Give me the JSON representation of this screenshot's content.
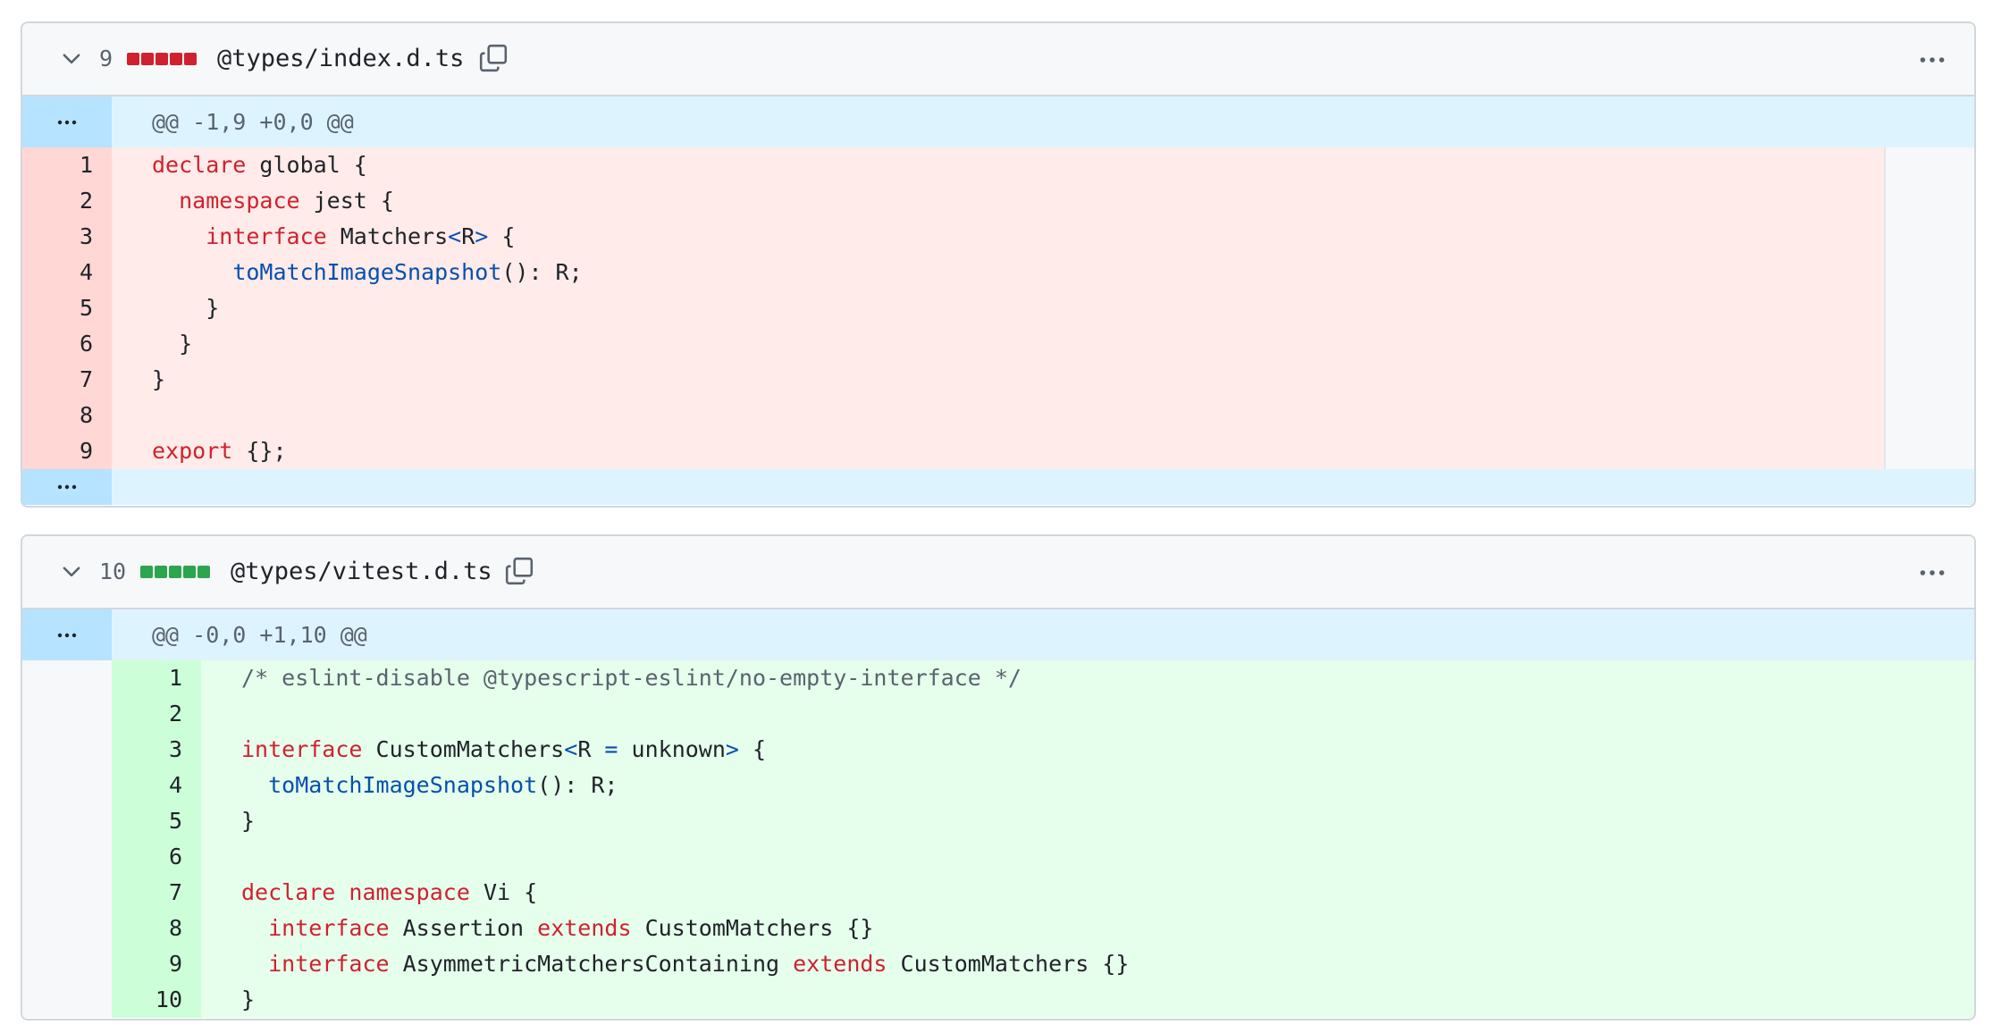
{
  "files": [
    {
      "count": "9",
      "kind": "deleted",
      "name": "@types/index.d.ts",
      "hunk": "@@ -1,9 +0,0 @@",
      "lines": [
        {
          "n": "1",
          "html": "<span class=\"k\">declare</span> global {"
        },
        {
          "n": "2",
          "html": "  <span class=\"k\">namespace</span> jest {"
        },
        {
          "n": "3",
          "html": "    <span class=\"k\">interface</span> Matchers<span class=\"p\">&lt;</span>R<span class=\"p\">&gt;</span> {"
        },
        {
          "n": "4",
          "html": "      <span class=\"f\">toMatchImageSnapshot</span>(): R;"
        },
        {
          "n": "5",
          "html": "    }"
        },
        {
          "n": "6",
          "html": "  }"
        },
        {
          "n": "7",
          "html": "}"
        },
        {
          "n": "8",
          "html": ""
        },
        {
          "n": "9",
          "html": "<span class=\"k\">export</span> {};"
        }
      ]
    },
    {
      "count": "10",
      "kind": "added",
      "name": "@types/vitest.d.ts",
      "hunk": "@@ -0,0 +1,10 @@",
      "lines": [
        {
          "n": "1",
          "html": "<span class=\"c\">/* eslint-disable @typescript-eslint/no-empty-interface */</span>"
        },
        {
          "n": "2",
          "html": ""
        },
        {
          "n": "3",
          "html": "<span class=\"k\">interface</span> CustomMatchers<span class=\"p\">&lt;</span>R <span class=\"p\">=</span> unknown<span class=\"p\">&gt;</span> {"
        },
        {
          "n": "4",
          "html": "  <span class=\"f\">toMatchImageSnapshot</span>(): R;"
        },
        {
          "n": "5",
          "html": "}"
        },
        {
          "n": "6",
          "html": ""
        },
        {
          "n": "7",
          "html": "<span class=\"k\">declare</span> <span class=\"k\">namespace</span> Vi {"
        },
        {
          "n": "8",
          "html": "  <span class=\"k\">interface</span> Assertion <span class=\"k\">extends</span> CustomMatchers {}"
        },
        {
          "n": "9",
          "html": "  <span class=\"k\">interface</span> AsymmetricMatchersContaining <span class=\"k\">extends</span> CustomMatchers {}"
        },
        {
          "n": "10",
          "html": "}"
        }
      ]
    }
  ],
  "colors": {
    "deleted_block": "#cf222e",
    "added_block": "#2da44e",
    "keyword": "#cf222e",
    "function": "#0550ae",
    "comment": "#59636e"
  },
  "icons": [
    "chevron-down-icon",
    "copy-icon",
    "kebab-horizontal-icon",
    "unfold-icon"
  ]
}
